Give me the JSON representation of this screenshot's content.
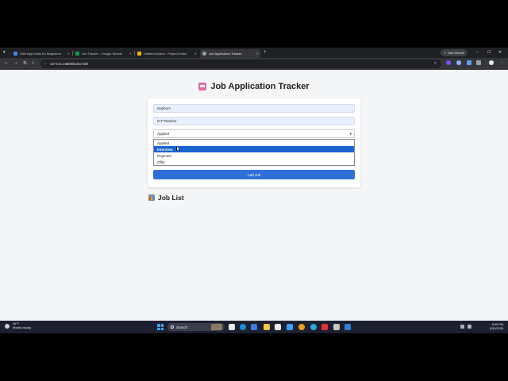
{
  "browser": {
    "tabs": [
      {
        "label": "Web App Ideas for Beginners",
        "active": false,
        "color": "#4285f4"
      },
      {
        "label": "Job Tracker - Google Sheets",
        "active": false,
        "color": "#0f9d58"
      },
      {
        "label": "Untitled project - Project Editor",
        "active": false,
        "color": "#f4b400"
      },
      {
        "label": "Job Application Tracker",
        "active": true,
        "color": "#9aa0a6"
      }
    ],
    "new_tab_label": "+",
    "gemini_label": "Ask Gemini",
    "url": "127.0.0.1:5500/index.html",
    "minimize": "–",
    "maximize": "☐",
    "close": "✕"
  },
  "app": {
    "title": "Job Application Tracker",
    "form": {
      "company_value": "Sophorn",
      "position_value": "ICT-Teacher",
      "status_selected": "Applied",
      "status_options": [
        "Applied",
        "Interview",
        "Rejected",
        "Offer"
      ],
      "highlighted_option": "Interview",
      "add_button": "Add Job"
    },
    "job_list_heading": "Job List"
  },
  "taskbar": {
    "temp": "26°F",
    "weather": "Mostly cloudy",
    "search_label": "Search",
    "time": "8:55 PM",
    "date": "5/30/2026"
  },
  "colors": {
    "accent": "#2f6fd9",
    "highlight": "#1a64d2"
  }
}
